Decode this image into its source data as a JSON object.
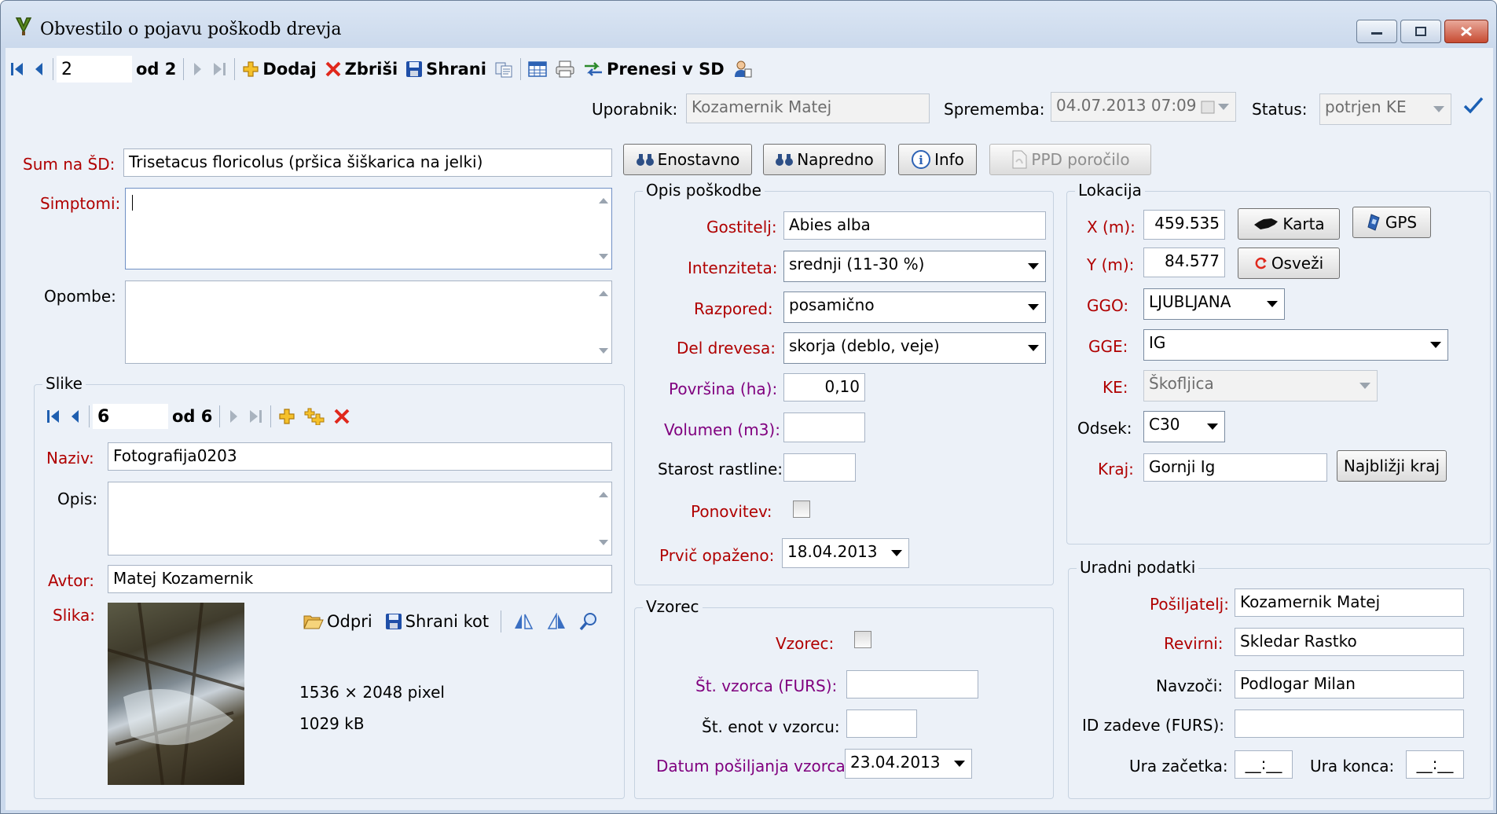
{
  "window": {
    "title": "Obvestilo o pojavu poškodb drevja"
  },
  "toolbar": {
    "record": "2",
    "of_label": "od 2",
    "add": "Dodaj",
    "delete": "Zbriši",
    "save": "Shrani",
    "transfer": "Prenesi v SD"
  },
  "header": {
    "user_label": "Uporabnik:",
    "user_value": "Kozamernik Matej",
    "change_label": "Sprememba:",
    "change_value": "04.07.2013 07:09",
    "status_label": "Status:",
    "status_value": "potrjen KE"
  },
  "left": {
    "pest_label": "Sum na ŠD:",
    "pest_value": "Trisetacus floricolus (pršica šiškarica na jelki)",
    "symptoms_label": "Simptomi:",
    "notes_label": "Opombe:"
  },
  "buttons": {
    "simple": "Enostavno",
    "advanced": "Napredno",
    "info": "Info",
    "report": "PPD poročilo"
  },
  "images": {
    "group": "Slike",
    "record": "6",
    "of_label": "od 6",
    "name_label": "Naziv:",
    "name_value": "Fotografija0203",
    "desc_label": "Opis:",
    "author_label": "Avtor:",
    "author_value": "Matej Kozamernik",
    "image_label": "Slika:",
    "open": "Odpri",
    "save_as": "Shrani kot",
    "dimensions": "1536 × 2048 pixel",
    "size": "1029 kB"
  },
  "damage": {
    "group": "Opis poškodbe",
    "host_label": "Gostitelj:",
    "host_value": "Abies alba",
    "intensity_label": "Intenziteta:",
    "intensity_value": "srednji (11-30 %)",
    "distribution_label": "Razpored:",
    "distribution_value": "posamično",
    "part_label": "Del drevesa:",
    "part_value": "skorja (deblo, veje)",
    "area_label": "Površina (ha):",
    "area_value": "0,10",
    "volume_label": "Volumen (m3):",
    "age_label": "Starost rastline:",
    "repeat_label": "Ponovitev:",
    "first_label": "Prvič opaženo:",
    "first_value": "18.04.2013"
  },
  "sample": {
    "group": "Vzorec",
    "sample_label": "Vzorec:",
    "number_label": "Št. vzorca (FURS):",
    "units_label": "Št. enot v vzorcu:",
    "date_label": "Datum pošiljanja vzorca:",
    "date_value": "23.04.2013"
  },
  "location": {
    "group": "Lokacija",
    "x_label": "X (m):",
    "x_value": "459.535",
    "y_label": "Y (m):",
    "y_value": "84.577",
    "map": "Karta",
    "gps": "GPS",
    "refresh": "Osveži",
    "ggo_label": "GGO:",
    "ggo_value": "LJUBLJANA",
    "gge_label": "GGE:",
    "gge_value": "IG",
    "ke_label": "KE:",
    "ke_value": "Škofljica",
    "section_label": "Odsek:",
    "section_value": "C30",
    "place_label": "Kraj:",
    "place_value": "Gornji Ig",
    "nearest": "Najbližji kraj"
  },
  "official": {
    "group": "Uradni podatki",
    "sender_label": "Pošiljatelj:",
    "sender_value": "Kozamernik Matej",
    "district_label": "Revirni:",
    "district_value": "Skledar Rastko",
    "present_label": "Navzoči:",
    "present_value": "Podlogar Milan",
    "case_label": "ID zadeve (FURS):",
    "start_label": "Ura začetka:",
    "start_value": "__:__",
    "end_label": "Ura konca:",
    "end_value": "__:__"
  },
  "colors": {
    "required": "#b00000",
    "optional": "#80007f",
    "accent": "#1a5fb4"
  }
}
